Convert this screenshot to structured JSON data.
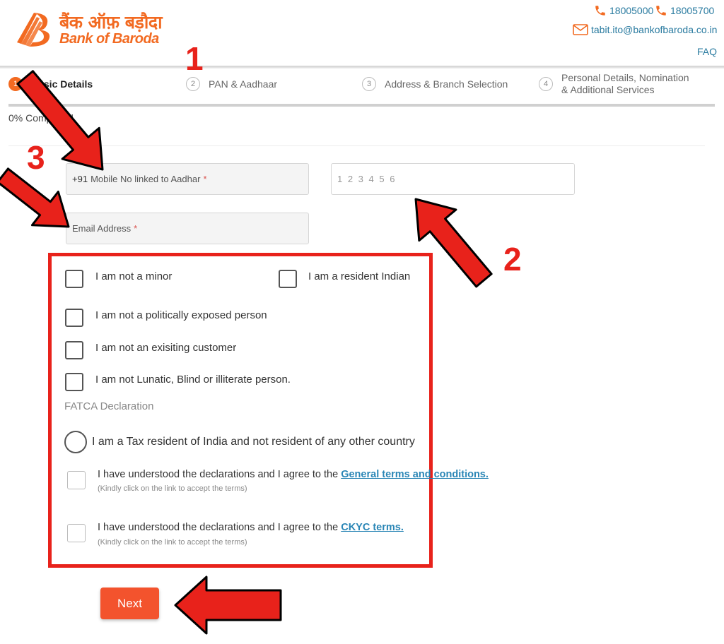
{
  "header": {
    "logo_hindi": "बैंक ऑफ़ बड़ौदा",
    "logo_english": "Bank of Baroda",
    "phone1": "18005000",
    "phone2": "18005700",
    "email": "tabit.ito@bankofbaroda.co.in",
    "faq": "FAQ",
    "brand_color": "#f26a21",
    "link_color": "#2a7ba0"
  },
  "steps": [
    {
      "num": "1",
      "label": "Basic Details",
      "active": true
    },
    {
      "num": "2",
      "label": "PAN & Aadhaar"
    },
    {
      "num": "3",
      "label": "Address & Branch Selection"
    },
    {
      "num": "4",
      "label_line1": "Personal Details, Nomination",
      "label_line2": "& Additional Services"
    }
  ],
  "progress": {
    "text": "0% Completed",
    "percent": 0
  },
  "form": {
    "mobile": {
      "prefix": "+91",
      "placeholder": "Mobile No linked to Aadhar",
      "required": "*"
    },
    "otp": {
      "value": "1 2 3 4 5 6"
    },
    "email": {
      "placeholder": "Email Address",
      "required": "*"
    }
  },
  "declarations": {
    "not_minor": "I am not a minor",
    "resident_indian": "I am a resident Indian",
    "not_pep": "I am not a politically exposed person",
    "not_existing": "I am not an exisiting customer",
    "not_lunatic": "I am not Lunatic, Blind or illiterate person.",
    "fatca_heading": "FATCA Declaration",
    "tax_resident": "I am a Tax resident of India and not resident of any other country",
    "terms1_text": "I have understood the declarations and I agree to the ",
    "terms1_link": "General terms  and conditions.",
    "terms1_note": "(Kindly click on the link to accept the terms)",
    "terms2_text": "I have understood the declarations and I agree to the ",
    "terms2_link": "CKYC terms.",
    "terms2_note": "(Kindly click on the link to accept the terms)"
  },
  "next_button": "Next",
  "annotations": {
    "n1": "1",
    "n2": "2",
    "n3": "3",
    "color": "#e8221b"
  }
}
